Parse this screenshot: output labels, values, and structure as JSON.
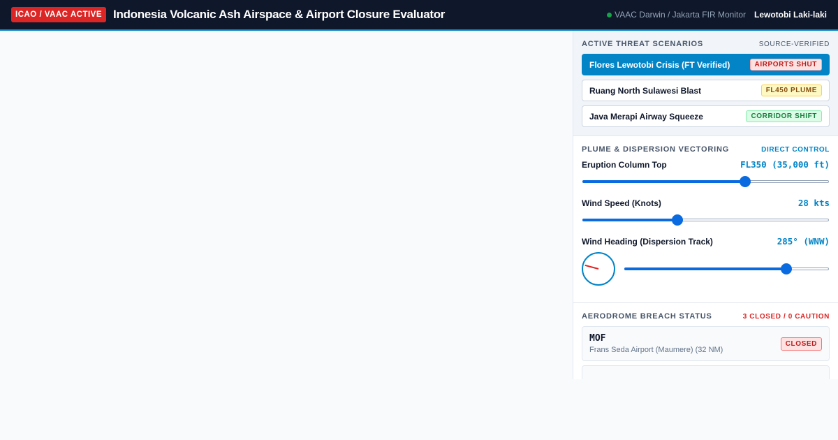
{
  "header": {
    "badge": "ICAO / VAAC ACTIVE",
    "title": "Indonesia Volcanic Ash Airspace & Airport Closure Evaluator",
    "monitor": "VAAC Darwin / Jakarta FIR Monitor",
    "volcano": "Lewotobi Laki-laki"
  },
  "threats": {
    "title": "ACTIVE THREAT SCENARIOS",
    "meta": "SOURCE-VERIFIED",
    "items": [
      {
        "label": "Flores Lewotobi Crisis (FT Verified)",
        "tag": "AIRPORTS SHUT",
        "selected": true
      },
      {
        "label": "Ruang North Sulawesi Blast",
        "tag": "FL450 PLUME",
        "selected": false
      },
      {
        "label": "Java Merapi Airway Squeeze",
        "tag": "CORRIDOR SHIFT",
        "selected": false
      }
    ]
  },
  "plume": {
    "title": "PLUME & DISPERSION VECTORING",
    "meta": "DIRECT CONTROL",
    "column_top": {
      "label": "Eruption Column Top",
      "value": "FL350 (35,000 ft)",
      "level": 0.66
    },
    "wind_speed": {
      "label": "Wind Speed (Knots)",
      "value": "28 kts",
      "level": 0.385
    },
    "wind_heading": {
      "label": "Wind Heading (Dispersion Track)",
      "value": "285° (WNW)",
      "degrees": 285,
      "level": 0.79
    }
  },
  "aerodromes": {
    "title": "AERODROME BREACH STATUS",
    "meta": "3 CLOSED / 0 CAUTION",
    "items": [
      {
        "code": "MOF",
        "name": "Frans Seda Airport (Maumere) (32 NM)",
        "status": "CLOSED"
      }
    ]
  },
  "colors": {
    "accent": "#0284c7",
    "alert": "#dc2626",
    "header_bg": "#0f172a",
    "slider": "#0a6be0"
  },
  "icons": [
    "live-status-dot-icon",
    "compass-icon"
  ]
}
